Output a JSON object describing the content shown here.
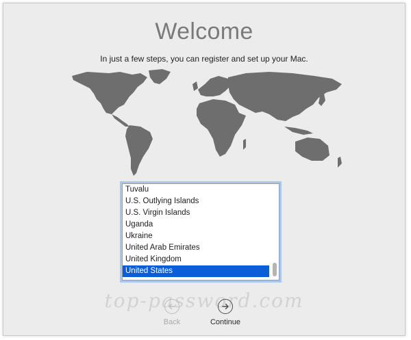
{
  "title": "Welcome",
  "subtitle": "In just a few steps, you can register and set up your Mac.",
  "countries": [
    "Tuvalu",
    "U.S. Outlying Islands",
    "U.S. Virgin Islands",
    "Uganda",
    "Ukraine",
    "United Arab Emirates",
    "United Kingdom",
    "United States"
  ],
  "selected_country": "United States",
  "watermark": "top-password.com",
  "nav": {
    "back_label": "Back",
    "continue_label": "Continue"
  },
  "icons": {
    "back": "arrow-left-circle-icon",
    "continue": "arrow-right-circle-icon",
    "map": "world-map"
  },
  "colors": {
    "selection": "#0a5fd8",
    "focus_ring": "#a9c6ef",
    "map": "#6e6e6e",
    "background": "#ececec"
  }
}
